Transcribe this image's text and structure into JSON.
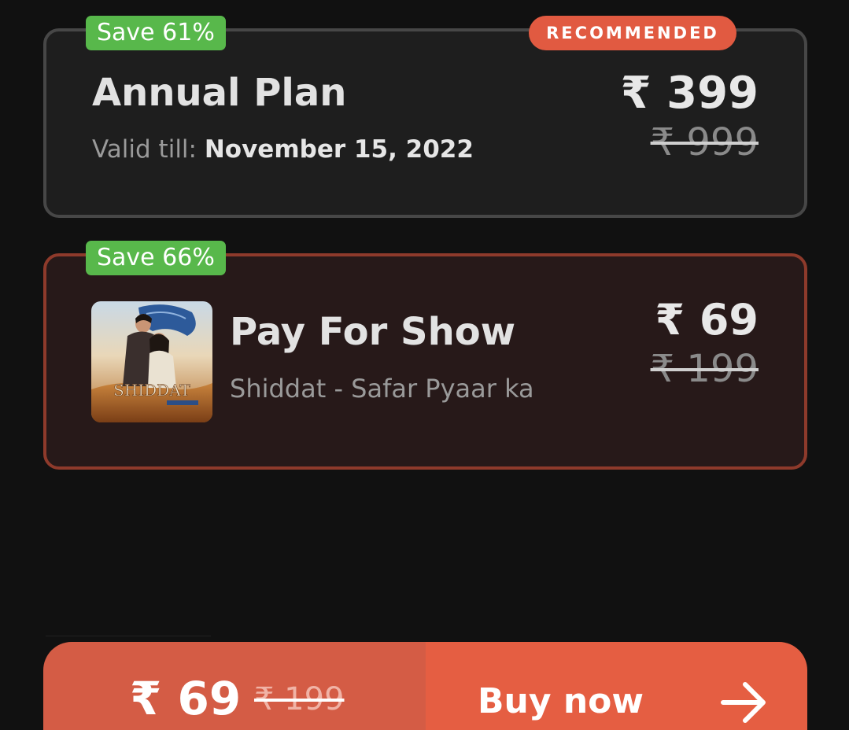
{
  "plans": {
    "annual": {
      "save_badge": "Save 61%",
      "recommended_badge": "RECOMMENDED",
      "title": "Annual Plan",
      "valid_label": "Valid till: ",
      "valid_date": "November 15, 2022",
      "price_now": "₹ 399",
      "price_was": "₹ 999"
    },
    "show": {
      "save_badge": "Save 66%",
      "title": "Pay For Show",
      "subtitle": "Shiddat - Safar Pyaar ka",
      "poster_text": "SHIDDAT",
      "price_now": "₹ 69",
      "price_was": "₹ 199"
    }
  },
  "purchase_bar": {
    "price_now": "₹ 69",
    "price_was": "₹ 199",
    "buy_label": "Buy now",
    "buy_icon": "arrow-right-icon"
  },
  "colors": {
    "background": "#111111",
    "save_badge": "#58b84b",
    "accent": "#e55e42",
    "selected_border": "#8e3a2b",
    "card_border": "#474747"
  }
}
